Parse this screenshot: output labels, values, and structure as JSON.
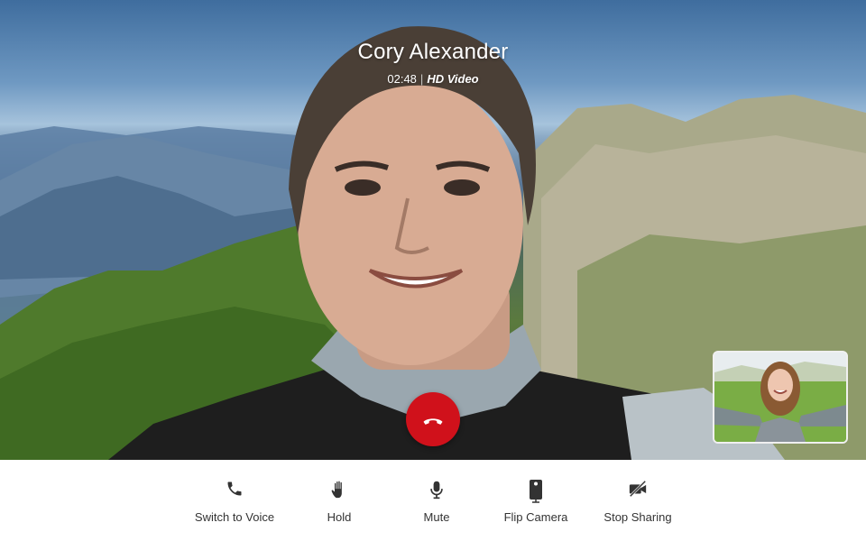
{
  "call": {
    "caller_name": "Cory Alexander",
    "duration": "02:48",
    "separator": "|",
    "quality": "HD Video"
  },
  "controls": [
    {
      "label": "Switch to Voice",
      "icon": "phone-icon"
    },
    {
      "label": "Hold",
      "icon": "hand-icon"
    },
    {
      "label": "Mute",
      "icon": "microphone-icon"
    },
    {
      "label": "Flip Camera",
      "icon": "phone-camera-icon"
    },
    {
      "label": "Stop Sharing",
      "icon": "video-off-icon"
    }
  ],
  "colors": {
    "end_call": "#d0111b",
    "toolbar_bg": "#ffffff",
    "label_text": "#333333",
    "icon": "#333333"
  }
}
